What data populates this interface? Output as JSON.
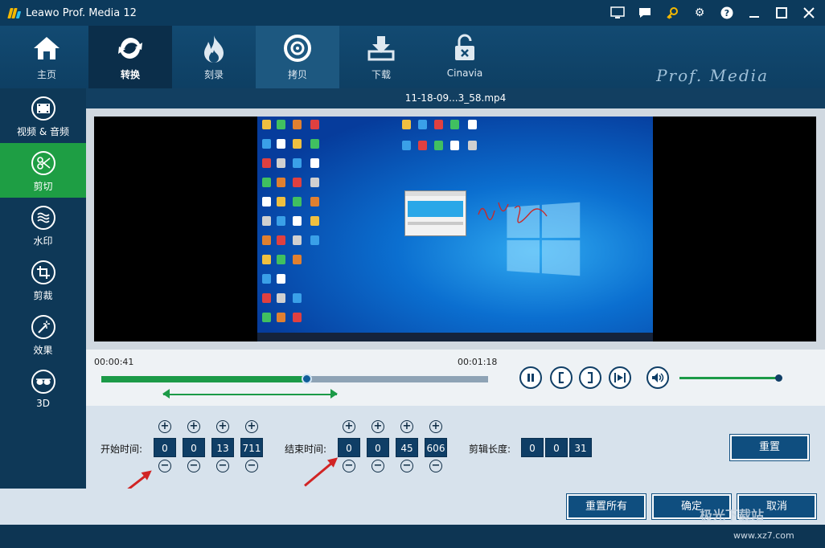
{
  "app": {
    "title": "Leawo Prof. Media 12"
  },
  "titlebar_icons": [
    "monitor-icon",
    "chat-icon",
    "key-icon",
    "gear-icon",
    "help-icon",
    "minimize-icon",
    "maximize-icon",
    "close-icon"
  ],
  "nav": [
    {
      "id": "home",
      "label": "主页",
      "icon": "home-icon"
    },
    {
      "id": "convert",
      "label": "转换",
      "icon": "convert-icon",
      "active": true
    },
    {
      "id": "burn",
      "label": "刻录",
      "icon": "flame-icon"
    },
    {
      "id": "copy",
      "label": "拷贝",
      "icon": "disc-icon",
      "highlight": true
    },
    {
      "id": "download",
      "label": "下载",
      "icon": "download-icon"
    },
    {
      "id": "cinavia",
      "label": "Cinavia",
      "icon": "unlock-icon"
    }
  ],
  "brand": "Prof. Media",
  "sidebar": [
    {
      "label": "视频 & 音频",
      "icon": "film-icon"
    },
    {
      "label": "剪切",
      "icon": "scissors-icon",
      "active": true
    },
    {
      "label": "水印",
      "icon": "waves-icon"
    },
    {
      "label": "剪裁",
      "icon": "crop-icon"
    },
    {
      "label": "效果",
      "icon": "magic-wand-icon"
    },
    {
      "label": "3D",
      "icon": "3d-glasses-icon"
    }
  ],
  "file": {
    "name": "11-18-09...3_58.mp4"
  },
  "player": {
    "current_time": "00:00:41",
    "end_time": "00:01:18",
    "progress": 0.53,
    "range_start": 0.16,
    "range_end": 0.61,
    "volume": 1.0
  },
  "trim": {
    "start_label": "开始时间:",
    "start": [
      "0",
      "0",
      "13",
      "711"
    ],
    "end_label": "结束时间:",
    "end": [
      "0",
      "0",
      "45",
      "606"
    ],
    "length_label": "剪辑长度:",
    "length": [
      "0",
      "0",
      "31"
    ],
    "reset_label": "重置"
  },
  "footer": {
    "reset_all": "重置所有",
    "ok": "确定",
    "cancel": "取消"
  },
  "watermark": {
    "name": "极光下载站",
    "url": "www.xz7.com"
  },
  "colors": {
    "accent_green": "#1e9e44",
    "nav_bg": "#124a72",
    "button_bg": "#0f4e7f"
  }
}
